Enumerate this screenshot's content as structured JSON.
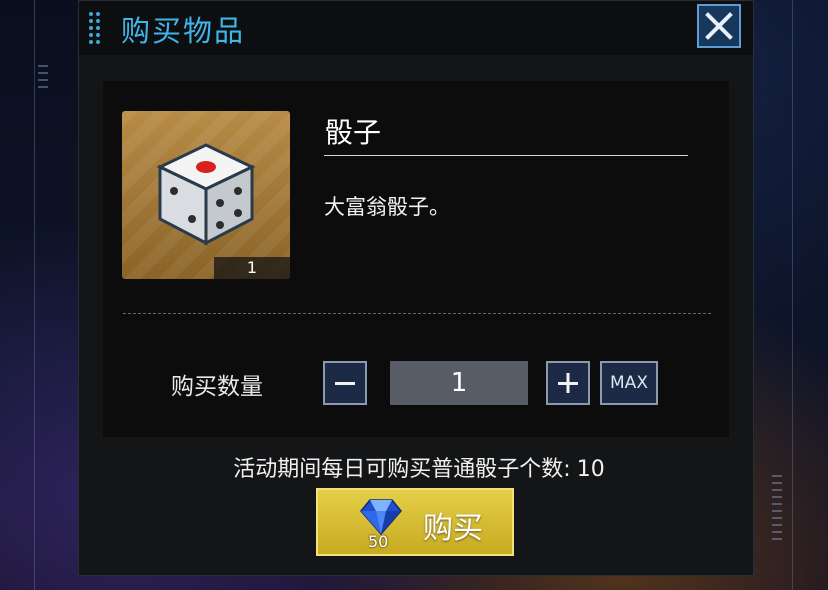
{
  "header": {
    "title": "购买物品",
    "close_icon": "close-icon"
  },
  "item": {
    "name": "骰子",
    "description": "大富翁骰子。",
    "owned_count": "1",
    "icon": "dice-icon"
  },
  "quantity": {
    "label": "购买数量",
    "value": "1",
    "max_label": "MAX"
  },
  "limit": {
    "text": "活动期间每日可购买普通骰子个数:",
    "value": "10"
  },
  "buy": {
    "label": "购买",
    "cost": "50",
    "currency_icon": "diamond-icon"
  },
  "colors": {
    "accent": "#3fb6ea",
    "buy_button": "#d8bd32",
    "panel": "#0c0c0d"
  }
}
